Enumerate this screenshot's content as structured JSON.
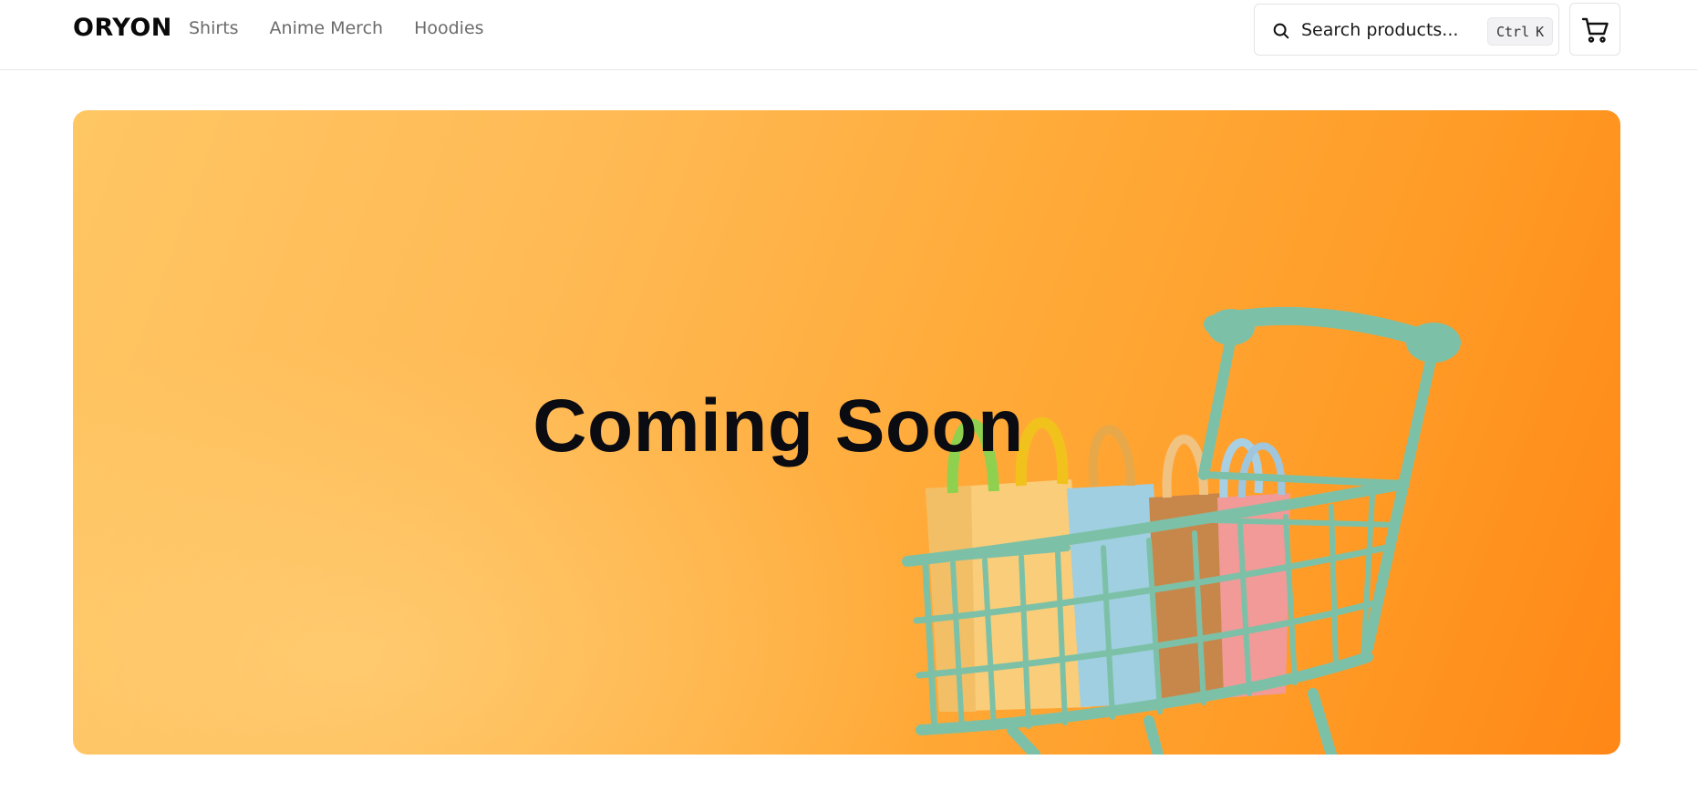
{
  "header": {
    "logo": "ORYON",
    "nav": [
      {
        "label": "Shirts"
      },
      {
        "label": "Anime Merch"
      },
      {
        "label": "Hoodies"
      }
    ],
    "search": {
      "placeholder": "Search products...",
      "shortcut_keys": [
        "Ctrl",
        "K"
      ],
      "icon": "search-icon"
    },
    "cart": {
      "icon": "cart-icon"
    }
  },
  "hero": {
    "title": "Coming Soon",
    "image": "shopping-cart-with-bags",
    "colors": {
      "gradient_start": "#ffc664",
      "gradient_end": "#ff8716",
      "cart_color": "#7cc1a7"
    }
  }
}
